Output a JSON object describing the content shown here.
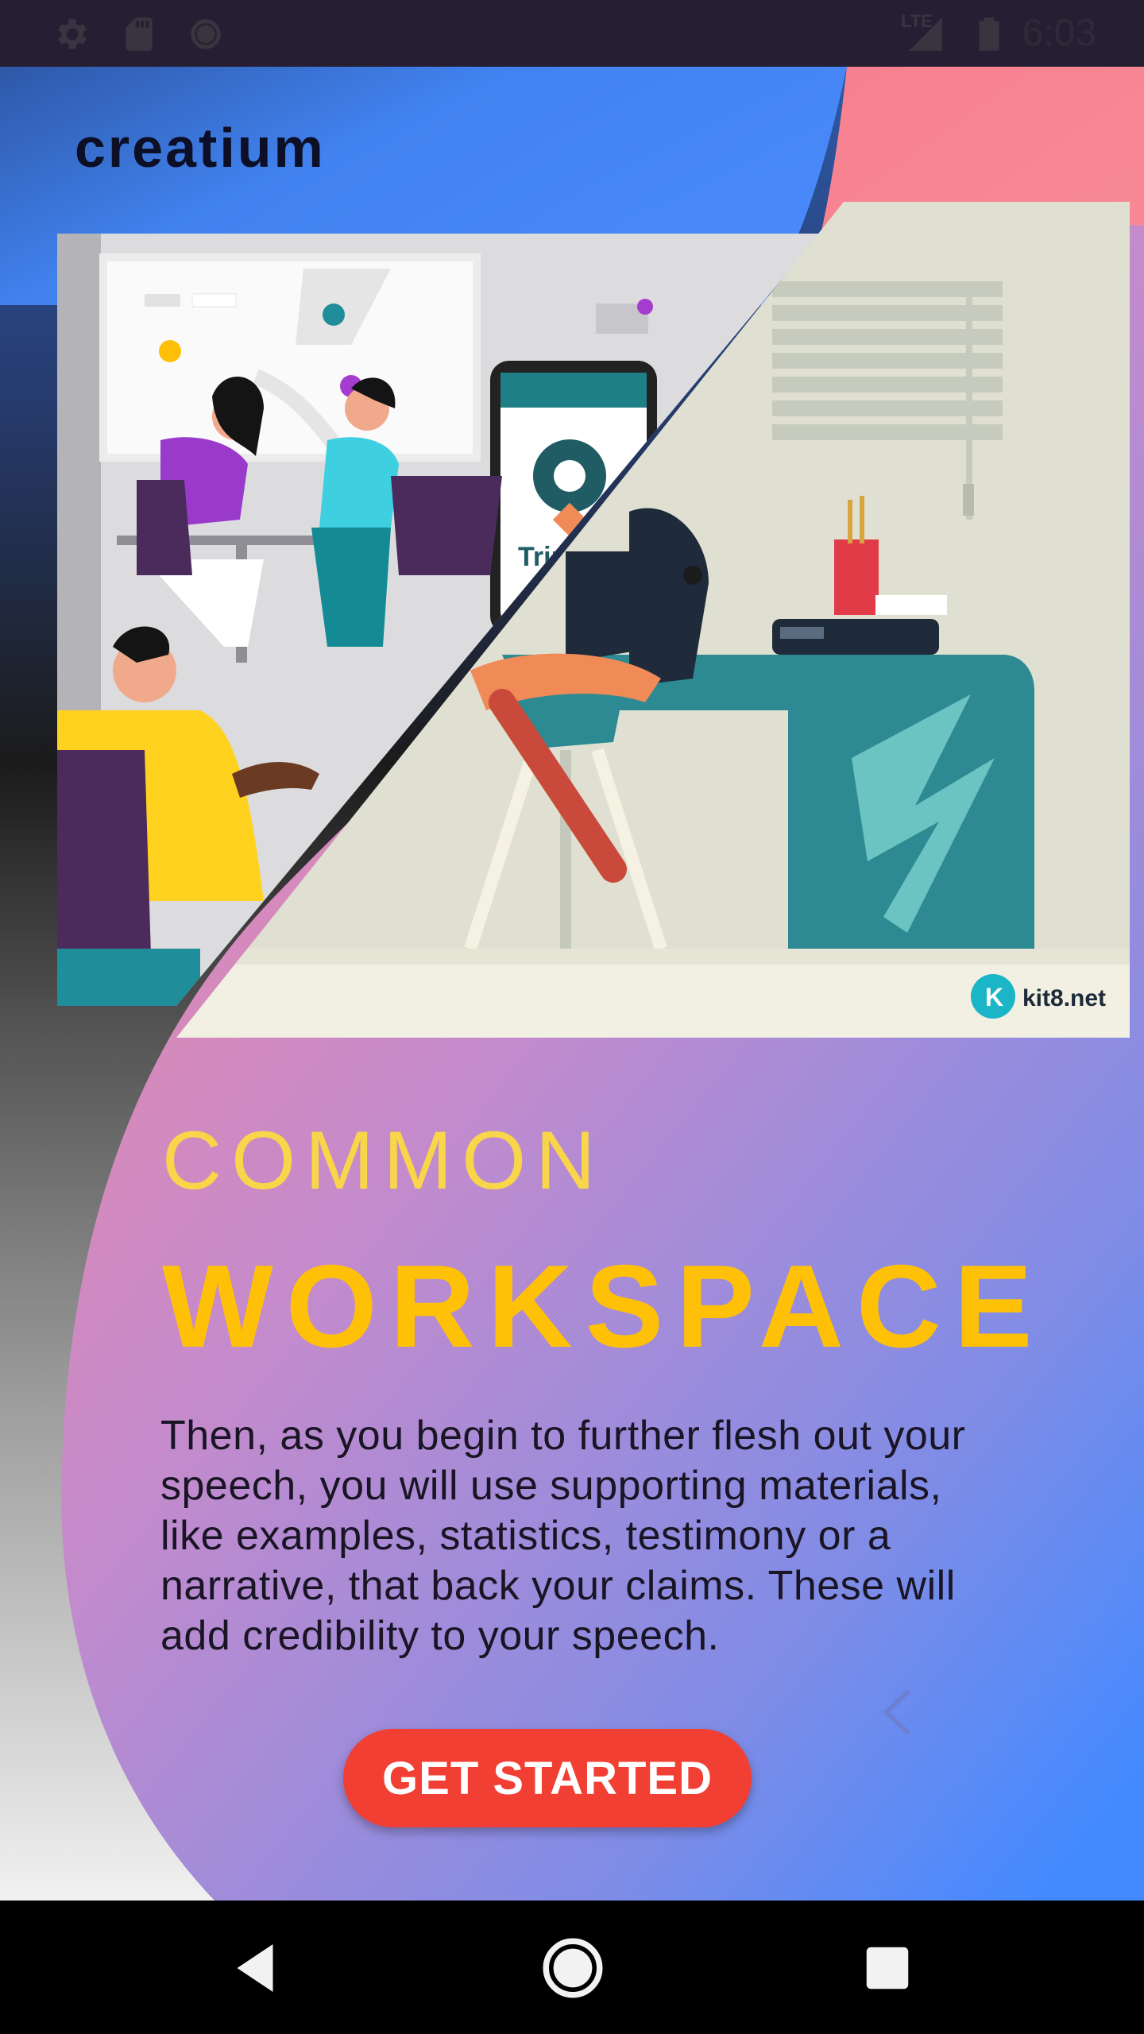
{
  "status_bar": {
    "time": "6:03",
    "network_label": "LTE",
    "left_icons": [
      "gear-icon",
      "sd-card-icon",
      "circle-icon"
    ],
    "right_icons": [
      "signal-icon",
      "battery-icon"
    ]
  },
  "app": {
    "brand": "creatium",
    "hero": {
      "phone_app_text": "TripPo",
      "watermark": "kit8.net"
    },
    "heading_light": "COMMON",
    "heading_bold": "WORKSPACE",
    "body": "Then, as you begin to further flesh out your speech, you will use supporting materials, like examples, statistics, testimony or a narrative, that back your claims. These will add credibility to your speech.",
    "cta_label": "GET STARTED",
    "colors": {
      "accent": "#f23f34",
      "heading": "#ffc107",
      "blue": "#448aff",
      "pink": "#f4869e"
    }
  },
  "nav_bar": {
    "items": [
      "back-icon",
      "home-icon",
      "recents-icon"
    ]
  }
}
